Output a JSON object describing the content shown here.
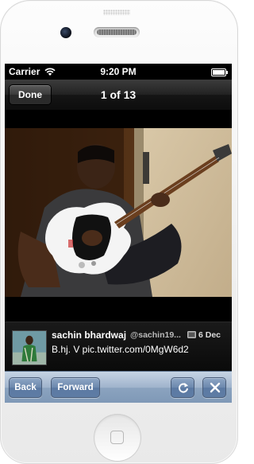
{
  "status_bar": {
    "carrier": "Carrier",
    "time": "9:20 PM"
  },
  "nav": {
    "done_label": "Done",
    "title": "1 of 13"
  },
  "tweet": {
    "name": "sachin bhardwaj",
    "handle": "@sachin19...",
    "date": "6 Dec",
    "text": "B.hj. V pic.twitter.com/0MgW6d2"
  },
  "toolbar": {
    "back_label": "Back",
    "forward_label": "Forward"
  },
  "icons": {
    "wifi": "wifi-icon",
    "battery": "battery-icon",
    "photo": "photo-attachment-icon",
    "refresh": "refresh-icon",
    "close": "close-icon"
  },
  "colors": {
    "toolbar": "#8ba3bf",
    "navbar": "#151515"
  }
}
